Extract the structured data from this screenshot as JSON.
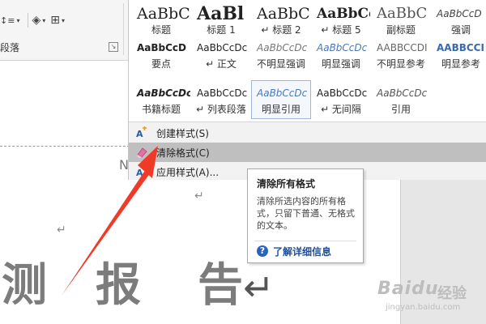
{
  "ribbon": {
    "group_label": "段落",
    "expander": "↘",
    "toolbar": [
      {
        "icon": "line-spacing-icon",
        "glyph": "↕≡"
      },
      {
        "icon": "shading-icon",
        "glyph": "◈"
      },
      {
        "icon": "borders-icon",
        "glyph": "⊞"
      }
    ]
  },
  "gallery": {
    "rows": [
      [
        {
          "sample": "AaBbC",
          "name": "标题",
          "size": 19,
          "weight": "normal",
          "style": "normal",
          "color": "#222222"
        },
        {
          "sample": "AaBl",
          "name": "标题 1",
          "size": 22,
          "weight": "bold",
          "style": "normal",
          "color": "#222222"
        },
        {
          "sample": "AaBbC",
          "name": "↵ 标题 2",
          "size": 19,
          "weight": "normal",
          "style": "normal",
          "color": "#222222"
        },
        {
          "sample": "AaBbCc",
          "name": "↵ 标题 5",
          "size": 17,
          "weight": "bold",
          "style": "normal",
          "color": "#222222"
        },
        {
          "sample": "AaBbC",
          "name": "副标题",
          "size": 18,
          "weight": "normal",
          "style": "normal",
          "color": "#555555"
        },
        {
          "sample": "AaBbCcD",
          "name": "强调",
          "size": 12,
          "weight": "normal",
          "style": "italic",
          "color": "#444444"
        }
      ],
      [
        {
          "sample": "AaBbCcD",
          "name": "要点",
          "size": 12,
          "weight": "bold",
          "style": "normal",
          "color": "#222222"
        },
        {
          "sample": "AaBbCcDc",
          "name": "↵ 正文",
          "size": 12,
          "weight": "normal",
          "style": "normal",
          "color": "#222222"
        },
        {
          "sample": "AaBbCcDc",
          "name": "不明显强调",
          "size": 12,
          "weight": "normal",
          "style": "italic",
          "color": "#777777"
        },
        {
          "sample": "AaBbCcDc",
          "name": "明显强调",
          "size": 12,
          "weight": "normal",
          "style": "italic",
          "color": "#4a78b5"
        },
        {
          "sample": "AABBCCDI",
          "name": "不明显参考",
          "size": 12,
          "weight": "normal",
          "style": "normal",
          "color": "#666666"
        },
        {
          "sample": "AABBCCI",
          "name": "明显参考",
          "size": 12,
          "weight": "bold",
          "style": "normal",
          "color": "#3c6aa8"
        }
      ],
      [
        {
          "sample": "AaBbCcDc",
          "name": "书籍标题",
          "size": 12,
          "weight": "bold",
          "style": "italic",
          "color": "#222222"
        },
        {
          "sample": "AaBbCcDc",
          "name": "↵ 列表段落",
          "size": 12,
          "weight": "normal",
          "style": "normal",
          "color": "#222222"
        },
        {
          "sample": "AaBbCcDc",
          "name": "明显引用",
          "size": 12,
          "weight": "normal",
          "style": "italic",
          "color": "#4a78b5",
          "selected": true
        },
        {
          "sample": "AaBbCcDc",
          "name": "↵ 无间隔",
          "size": 12,
          "weight": "normal",
          "style": "normal",
          "color": "#222222"
        },
        {
          "sample": "AaBbCcDc",
          "name": "引用",
          "size": 12,
          "weight": "normal",
          "style": "italic",
          "color": "#555555"
        }
      ]
    ]
  },
  "menu": {
    "create_style": "创建样式(S)",
    "clear_formatting": "清除格式(C)",
    "apply_styles": "应用样式(A)..."
  },
  "tooltip": {
    "title": "清除所有格式",
    "body": "清除所选内容的所有格式，只留下普通、无格式的文本。",
    "help": "了解详细信息",
    "help_glyph": "?"
  },
  "document": {
    "title_chars": [
      "测",
      "报",
      "告"
    ],
    "return_mark": "↵",
    "partial_text": "N"
  },
  "watermark": {
    "brand": "Baidu",
    "cn": "经验",
    "url": "jingyan.baidu.com"
  },
  "colors": {
    "arrow": "#f03a28",
    "menu_hover": "#bfbfbf",
    "help_blue": "#1f4e9a"
  }
}
